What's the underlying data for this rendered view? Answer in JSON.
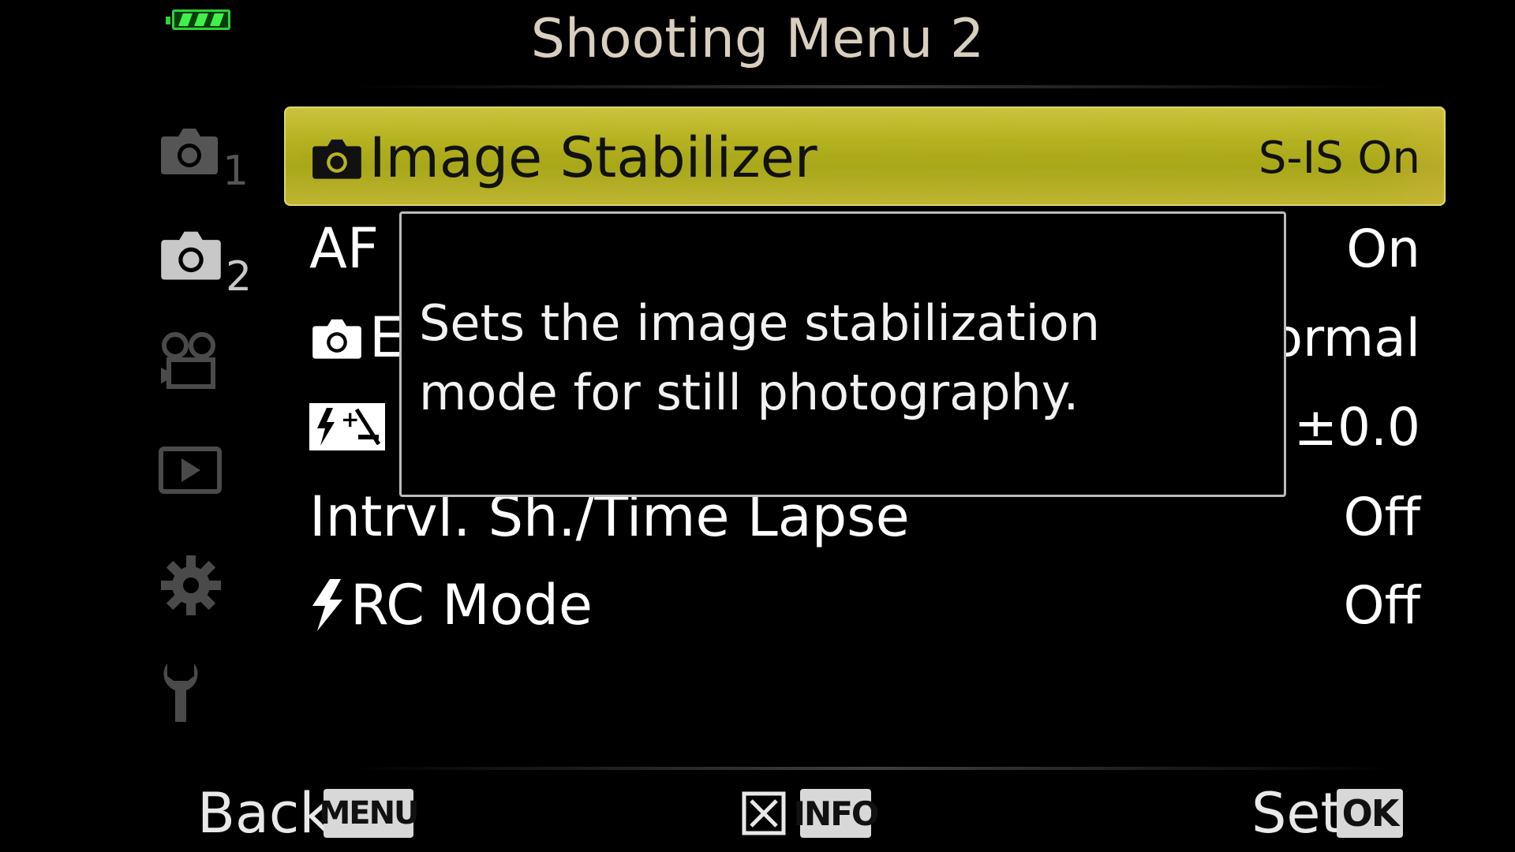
{
  "status": {
    "battery_icon": "battery-full-icon",
    "battery_color": "#2fd13a"
  },
  "header": {
    "title": "Shooting Menu 2"
  },
  "sidebar": {
    "tabs": [
      {
        "icon": "camera-icon",
        "sub": "1"
      },
      {
        "icon": "camera-icon",
        "sub": "2",
        "active": true
      },
      {
        "icon": "video-camera-icon"
      },
      {
        "icon": "playback-icon"
      },
      {
        "icon": "gear-icon"
      },
      {
        "icon": "wrench-icon"
      }
    ]
  },
  "menu": {
    "highlight_color": "#b4b422",
    "items": [
      {
        "label": "Image Stabilizer",
        "icon": "camera-icon",
        "value": "S-IS On"
      },
      {
        "label": "AF I",
        "value": "On"
      },
      {
        "label": "E",
        "icon": "camera-icon",
        "value": "lormal"
      },
      {
        "label": "",
        "icon": "flash-compensation-icon",
        "value": "±0.0"
      },
      {
        "label": "Intrvl. Sh./Time Lapse",
        "value": "Off"
      },
      {
        "label": "RC Mode",
        "icon": "flash-icon",
        "value": "Off"
      }
    ]
  },
  "tooltip": {
    "text": "Sets the image stabilization mode for still photography."
  },
  "footer": {
    "back_label": "Back",
    "back_key": "MENU",
    "delete_icon": "delete-icon",
    "info_key": "INFO",
    "set_label": "Set",
    "set_key": "OK"
  }
}
